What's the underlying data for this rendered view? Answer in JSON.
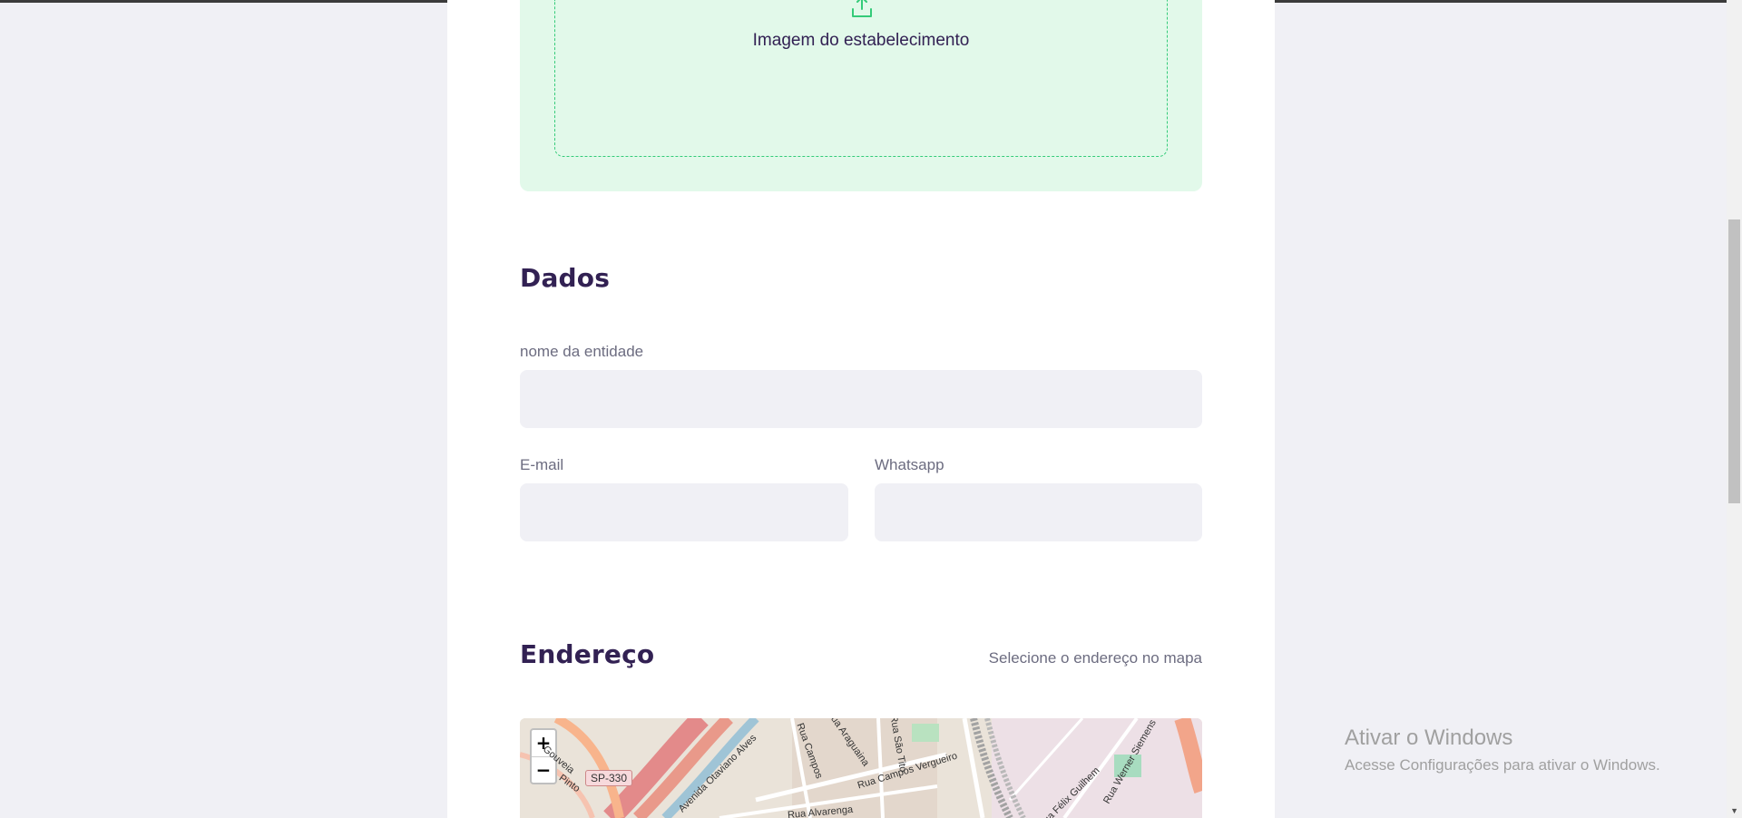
{
  "upload": {
    "label": "Imagem do estabelecimento"
  },
  "dados": {
    "title": "Dados",
    "name_label": "nome da entidade",
    "email_label": "E-mail",
    "whatsapp_label": "Whatsapp"
  },
  "endereco": {
    "title": "Endereço",
    "hint": "Selecione o endereço no mapa"
  },
  "map": {
    "zoom_in": "+",
    "zoom_out": "−",
    "shield": "SP-330",
    "labels": [
      "Avenida Otaviano Alves",
      "Rua Campos Vergueiro",
      "Rua São Tito",
      "Rua Araguaina",
      "Rua Campos",
      "Rua Alvarenga",
      "Rua Werner Siemens",
      "Rua Félix Guilhem",
      "Pinto",
      "Gouveia"
    ]
  },
  "windows": {
    "title": "Ativar o Windows",
    "subtitle": "Acesse Configurações para ativar o Windows."
  },
  "colors": {
    "accent": "#34cb79",
    "title": "#322153",
    "text": "#6c6c80",
    "input_bg": "#f0f0f5"
  }
}
